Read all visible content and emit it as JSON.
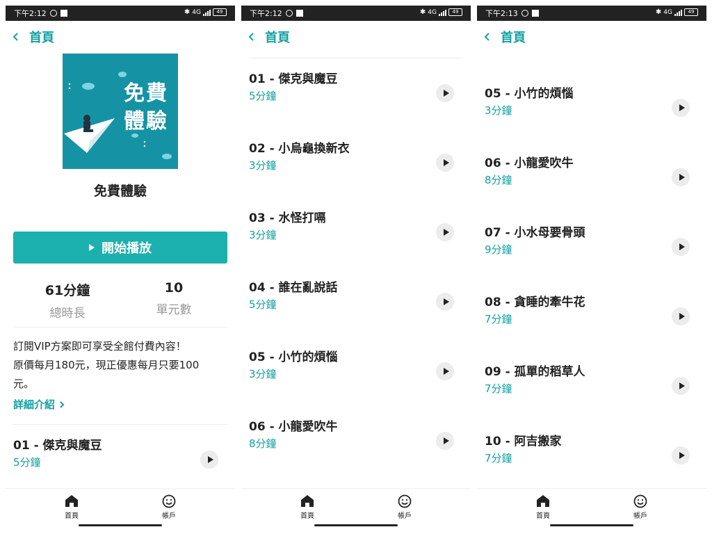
{
  "status": {
    "times": [
      "下午2:12",
      "下午2:12",
      "下午2:13"
    ],
    "network": "4G",
    "battery": "49"
  },
  "nav": {
    "back_label": "首頁"
  },
  "course": {
    "cover_line1": "免費",
    "cover_line2": "體驗",
    "title": "免費體驗",
    "play_label": "開始播放",
    "total_duration_value": "61分鐘",
    "total_duration_label": "總時長",
    "units_value": "10",
    "units_label": "單元數",
    "promo_line1": "訂閱VIP方案即可享受全館付費內容！",
    "promo_line2": "原價每月180元，現正優惠每月只要100",
    "promo_line3": "元。",
    "more_label": "詳細介紹"
  },
  "episodes": [
    {
      "title": "01 - 傑克與魔豆",
      "duration": "5分鐘"
    },
    {
      "title": "02 - 小烏龜換新衣",
      "duration": "3分鐘"
    },
    {
      "title": "03 - 水怪打嗝",
      "duration": "3分鐘"
    },
    {
      "title": "04 - 誰在亂說話",
      "duration": "5分鐘"
    },
    {
      "title": "05 - 小竹的煩惱",
      "duration": "3分鐘"
    },
    {
      "title": "06 - 小龍愛吹牛",
      "duration": "8分鐘"
    },
    {
      "title": "07 - 小水母要骨頭",
      "duration": "9分鐘"
    },
    {
      "title": "08 - 貪睡的牽牛花",
      "duration": "7分鐘"
    },
    {
      "title": "09 - 孤單的稻草人",
      "duration": "7分鐘"
    },
    {
      "title": "10 - 阿吉搬家",
      "duration": "7分鐘"
    }
  ],
  "tabbar": {
    "home_label": "首頁",
    "account_label": "帳戶"
  },
  "icons": {
    "back": "chevron-left-icon",
    "play": "play-icon",
    "home": "home-icon",
    "account": "smiley-face-icon",
    "more": "chevron-right-icon"
  },
  "colors": {
    "accent": "#14a0a0",
    "button": "#1cb0ae",
    "cover": "#1593a4"
  }
}
